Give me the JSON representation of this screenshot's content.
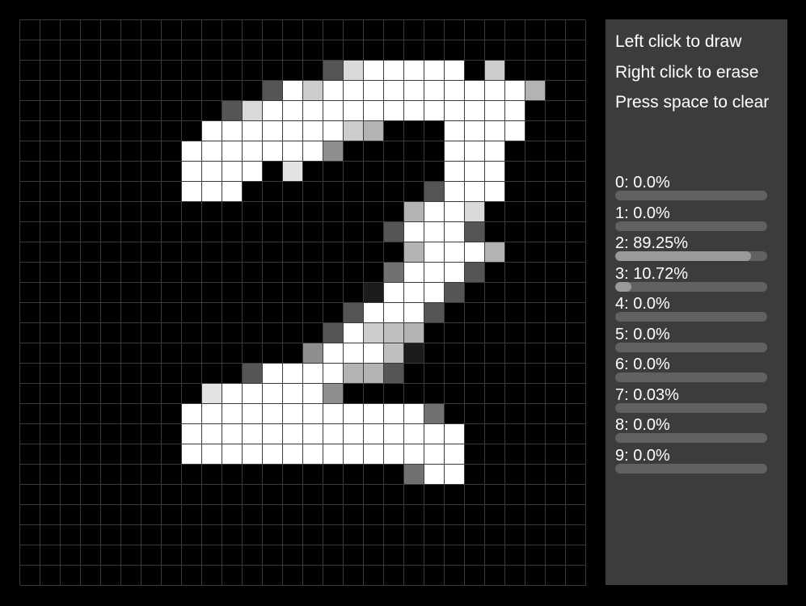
{
  "canvas": {
    "rows": 28,
    "cols": 28,
    "background": "#000000",
    "grid_line_color": "#3a3a3a",
    "pixels": [
      "0000000000000000000000000000",
      "0000000000000000000000000000",
      "0000000000000003E999990D0000",
      "00000000000039D9999999999B00",
      "00000000003E99999999999990000",
      "0000000009999999DB00099990000",
      "0000000099999995000009990000",
      "0000000099990800000009990000",
      "0000000099900000000039990000",
      "0000000000000000000B99E00000",
      "0000000000000000003999300000",
      "0000000000000000000B999B0000",
      "0000000000000000004999300000",
      "0000000000000000019993000000",
      "00000000000000003999300000000",
      "00000000000000039DCB000000000",
      "000000000000005999C100000000",
      "0000000000039999BB30000000000",
      "00000000089999950000000000000",
      "0000000099999999999940000000",
      "0000000099999999999999000000",
      "0000000099999999999999000000",
      "0000000000000000000499000000",
      "0000000000000000000000000000",
      "0000000000000000000000000000",
      "0000000000000000000000000000",
      "0000000000000000000000000000",
      "0000000000000000000000000000"
    ]
  },
  "panel": {
    "background": "#3c3c3c",
    "instructions": {
      "draw": "Left click to draw",
      "erase": "Right click to erase",
      "clear": "Press space to clear"
    }
  },
  "predictions": [
    {
      "label": "0: 0.0%",
      "value": 0.0
    },
    {
      "label": "1: 0.0%",
      "value": 0.0
    },
    {
      "label": "2: 89.25%",
      "value": 89.25
    },
    {
      "label": "3: 10.72%",
      "value": 10.72
    },
    {
      "label": "4: 0.0%",
      "value": 0.0
    },
    {
      "label": "5: 0.0%",
      "value": 0.0
    },
    {
      "label": "6: 0.0%",
      "value": 0.0
    },
    {
      "label": "7: 0.03%",
      "value": 0.03
    },
    {
      "label": "8: 0.0%",
      "value": 0.0
    },
    {
      "label": "9: 0.0%",
      "value": 0.0
    }
  ],
  "colors": {
    "bar_track": "#616161",
    "bar_fill": "#9a9a9a",
    "text": "#ffffff"
  }
}
